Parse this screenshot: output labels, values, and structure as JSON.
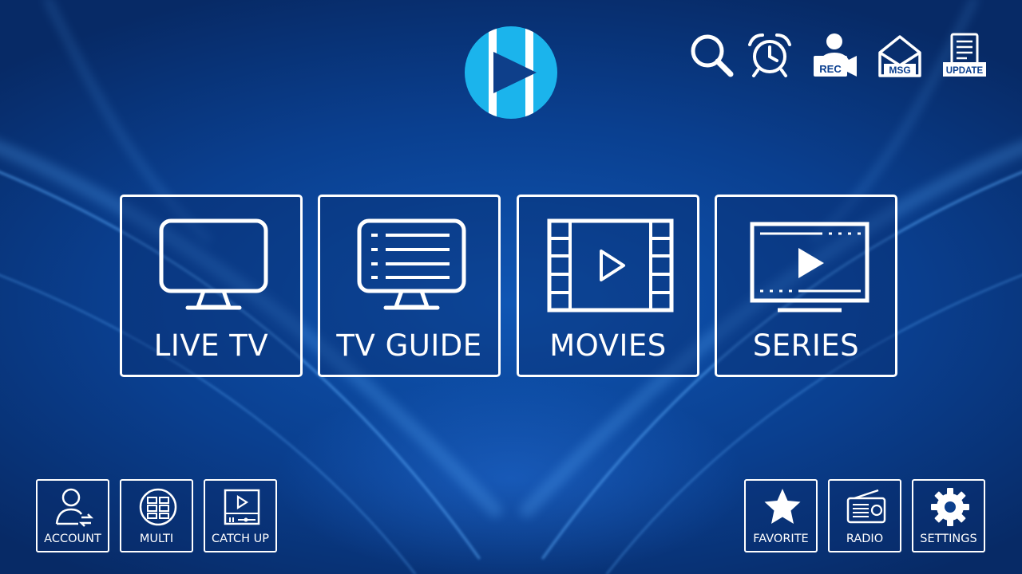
{
  "app": {
    "logo_icon": "play-logo-icon"
  },
  "top_icons": [
    {
      "name": "search-icon",
      "label": ""
    },
    {
      "name": "alarm-clock-icon",
      "label": ""
    },
    {
      "name": "record-icon",
      "label": "REC"
    },
    {
      "name": "message-icon",
      "label": "MSG"
    },
    {
      "name": "update-icon",
      "label": "UPDATE"
    }
  ],
  "tiles": [
    {
      "label": "LIVE TV",
      "icon": "tv-icon"
    },
    {
      "label": "TV GUIDE",
      "icon": "tv-guide-icon"
    },
    {
      "label": "MOVIES",
      "icon": "film-icon"
    },
    {
      "label": "SERIES",
      "icon": "series-play-icon"
    }
  ],
  "bottom_left": [
    {
      "label": "ACCOUNT",
      "icon": "account-icon"
    },
    {
      "label": "MULTI",
      "icon": "multi-screen-icon"
    },
    {
      "label": "CATCH UP",
      "icon": "catch-up-icon"
    }
  ],
  "bottom_right": [
    {
      "label": "FAVORITE",
      "icon": "star-icon"
    },
    {
      "label": "RADIO",
      "icon": "radio-icon"
    },
    {
      "label": "SETTINGS",
      "icon": "gear-icon"
    }
  ],
  "colors": {
    "accent": "#1bb4ec",
    "background": "#0a3f8f",
    "foreground": "#ffffff"
  }
}
